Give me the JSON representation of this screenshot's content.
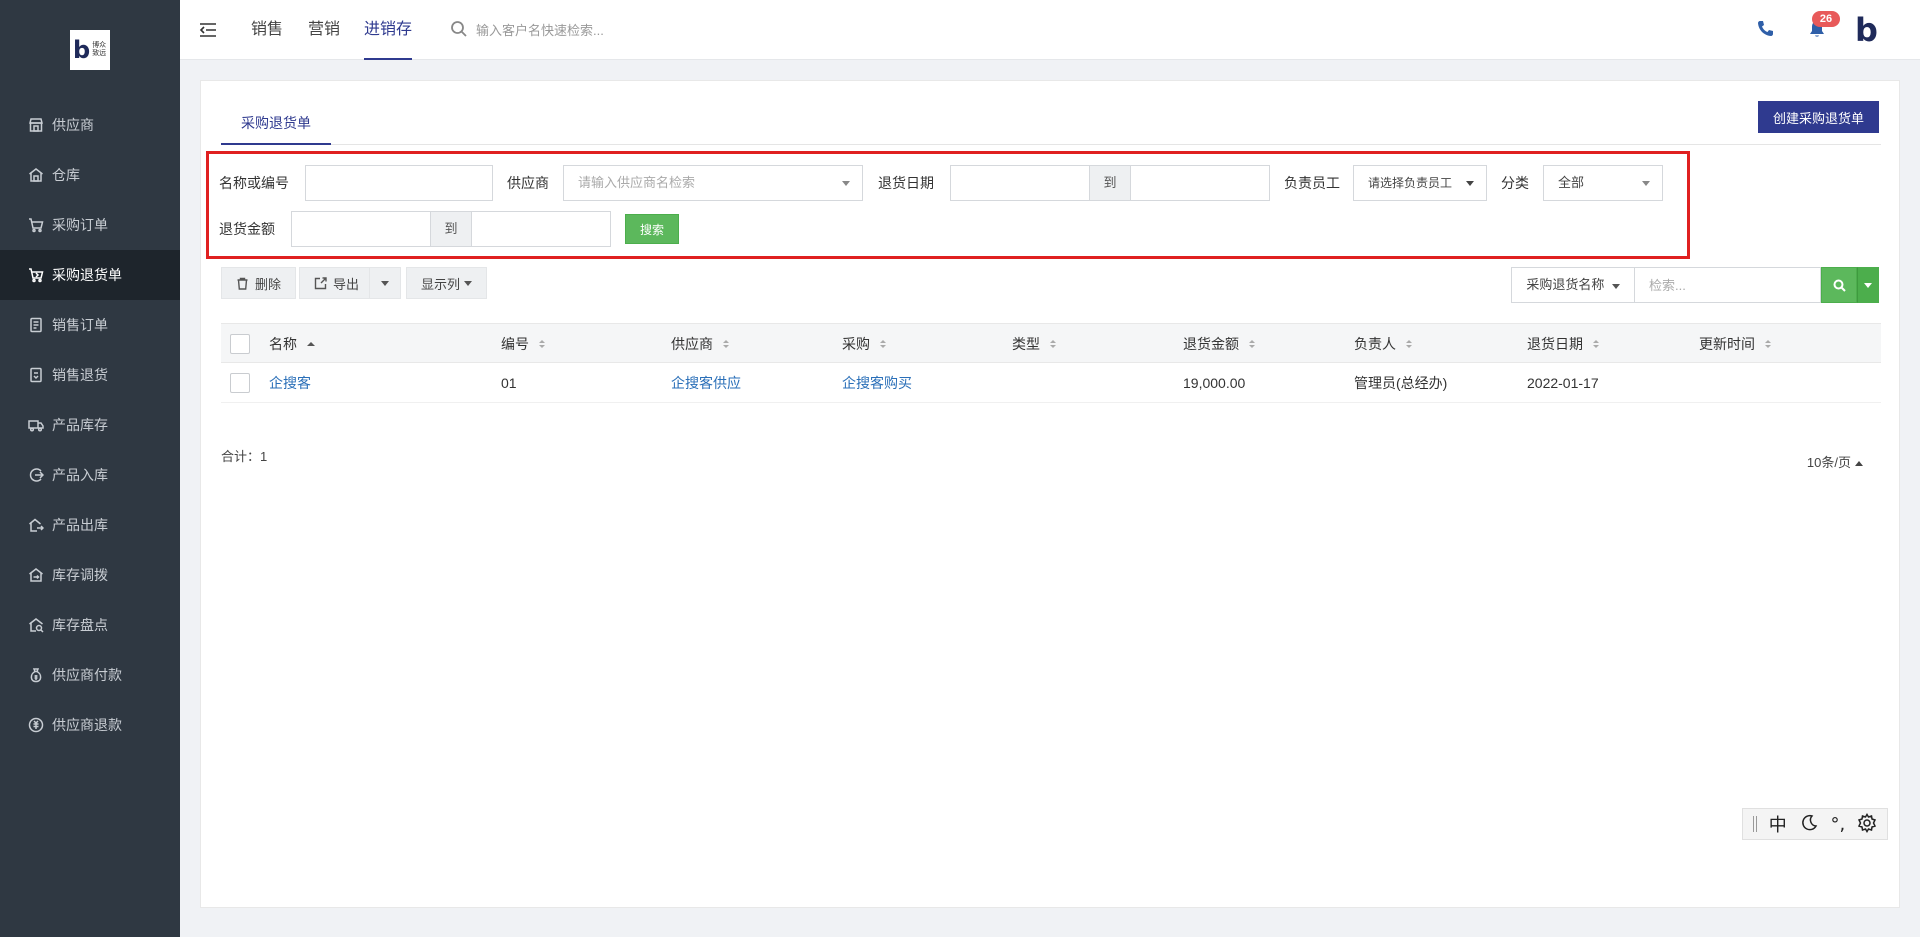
{
  "sidebar": {
    "logo_text_line1": "博众",
    "logo_text_line2": "致远",
    "items": [
      {
        "label": "供应商",
        "icon": "store-icon"
      },
      {
        "label": "仓库",
        "icon": "warehouse-icon"
      },
      {
        "label": "采购订单",
        "icon": "cart-icon"
      },
      {
        "label": "采购退货单",
        "icon": "cart-return-icon",
        "active": true
      },
      {
        "label": "销售订单",
        "icon": "order-icon"
      },
      {
        "label": "销售退货",
        "icon": "return-doc-icon"
      },
      {
        "label": "产品库存",
        "icon": "truck-icon"
      },
      {
        "label": "产品入库",
        "icon": "inbound-icon"
      },
      {
        "label": "产品出库",
        "icon": "outbound-icon"
      },
      {
        "label": "库存调拨",
        "icon": "transfer-icon"
      },
      {
        "label": "库存盘点",
        "icon": "inventory-check-icon"
      },
      {
        "label": "供应商付款",
        "icon": "money-bag-icon"
      },
      {
        "label": "供应商退款",
        "icon": "refund-icon"
      }
    ]
  },
  "topbar": {
    "tabs": [
      "销售",
      "营销",
      "进销存"
    ],
    "active_tab": "进销存",
    "search_placeholder": "输入客户名快速检索...",
    "notification_count": "26",
    "brand_letter": "b"
  },
  "page": {
    "tab_label": "采购退货单",
    "create_button": "创建采购退货单"
  },
  "filters": {
    "name_or_code_label": "名称或编号",
    "supplier_label": "供应商",
    "supplier_placeholder": "请输入供应商名检索",
    "return_date_label": "退货日期",
    "to_label": "到",
    "owner_label": "负责员工",
    "owner_placeholder": "请选择负责员工",
    "category_label": "分类",
    "category_value": "全部",
    "amount_label": "退货金额",
    "search_button": "搜索"
  },
  "toolbar": {
    "delete_label": "删除",
    "export_label": "导出",
    "columns_label": "显示列",
    "search_field_select": "采购退货名称",
    "search_placeholder": "检索..."
  },
  "table": {
    "columns": [
      "名称",
      "编号",
      "供应商",
      "采购",
      "类型",
      "退货金额",
      "负责人",
      "退货日期",
      "更新时间"
    ],
    "rows": [
      {
        "name": "企搜客",
        "code": "01",
        "supplier": "企搜客供应",
        "purchase": "企搜客购买",
        "type": "",
        "amount": "19,000.00",
        "owner": "管理员(总经办)",
        "date": "2022-01-17",
        "updated": ""
      }
    ]
  },
  "footer": {
    "total_text": "合计：1",
    "page_size": "10条/页"
  },
  "ime": {
    "lang": "中",
    "punct": "°,"
  },
  "colors": {
    "sidebar_bg": "#2f3842",
    "primary": "#2f3a8f",
    "success": "#5cb85c",
    "highlight_border": "#e02020",
    "link": "#2a6fb8"
  }
}
